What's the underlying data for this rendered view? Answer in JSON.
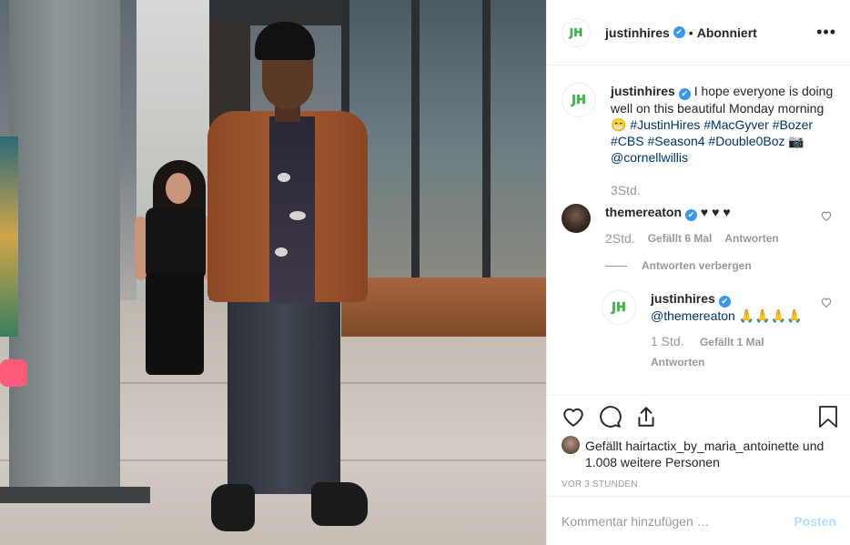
{
  "post": {
    "username": "justinhires",
    "verified_mark": "✔",
    "separator": "•",
    "follow_state": "Abonniert",
    "avatar_text": "JH",
    "more_icon": "•••"
  },
  "caption": {
    "username": "justinhires",
    "text_intro": "I hope everyone is doing well on this beautiful Monday morning😁",
    "hashtags": [
      "#JustinHires",
      "#MacGyver",
      "#Bozer",
      "#CBS",
      "#Season4",
      "#Double0Boz"
    ],
    "camera_glyph": "📷",
    "mention": "@cornellwillis",
    "time": "3Std."
  },
  "comments": [
    {
      "username": "themereaton",
      "text": "♥ ♥ ♥",
      "time": "2Std.",
      "likes": "Gefällt 6 Mal",
      "reply_label": "Antworten",
      "replies_toggle": "Antworten verbergen",
      "replies": [
        {
          "username": "justinhires",
          "mention": "@themereaton",
          "text": "🙏🙏🙏🙏",
          "time": "1 Std.",
          "likes": "Gefällt 1 Mal",
          "reply_label": "Antworten"
        }
      ]
    }
  ],
  "likes": {
    "prefix": "Gefällt",
    "liker": "hairtactix_by_maria_antoinette",
    "and": "und",
    "others": "1.008 weitere Personen"
  },
  "timestamp": "VOR 3 STUNDEN",
  "comment_box": {
    "placeholder": "Kommentar hinzufügen …",
    "post_label": "Posten"
  },
  "colors": {
    "link": "#003569",
    "verified": "#3897f0",
    "muted": "#999999",
    "post_disabled": "#b2dffc"
  },
  "icons": [
    "heart-icon",
    "comment-icon",
    "share-icon",
    "bookmark-icon",
    "more-icon"
  ]
}
